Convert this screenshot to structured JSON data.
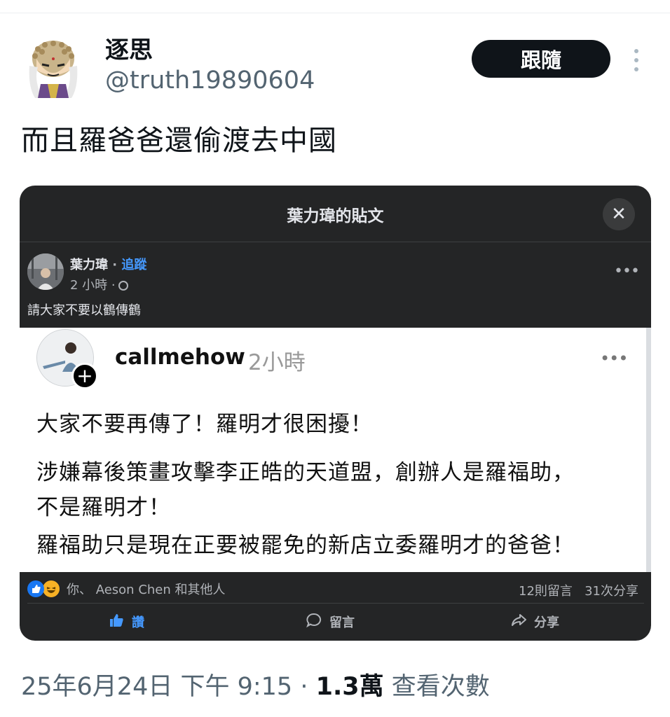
{
  "tweet": {
    "author_name": "逐思",
    "author_handle": "@truth19890604",
    "follow_label": "跟隨",
    "text": "而且羅爸爸還偷渡去中國",
    "date": "25年6月24日 下午 9:15",
    "separator": "·",
    "views_count": "1.3萬",
    "views_label": "查看次數"
  },
  "embedded": {
    "modal_title": "葉力瑋的貼文",
    "close_icon": "✕",
    "post_author": "葉力瑋",
    "dot": "·",
    "follow_label": "追蹤",
    "post_time": "2 小時 ·",
    "more_icon": "•••",
    "caption": "請大家不要以鶴傳鶴",
    "threads": {
      "username": "callmehow",
      "time": "2小時",
      "more_icon": "•••",
      "plus_icon": "+",
      "lines": [
        "大家不要再傳了！羅明才很困擾！",
        "涉嫌幕後策畫攻擊李正皓的天道盟，創辦人是羅福助，",
        "不是羅明才！",
        "羅福助只是現在正要被罷免的新店立委羅明才的爸爸！"
      ]
    },
    "reactions_text": "你、 Aeson Chen 和其他人",
    "comments": "12則留言",
    "shares": "31次分享",
    "actions": {
      "like": "讚",
      "comment": "留言",
      "share": "分享"
    }
  },
  "icons": {
    "more_vert": "vertical-ellipsis-icon",
    "like": "thumbs-up-icon",
    "comment": "speech-bubble-icon",
    "share": "share-arrow-icon"
  }
}
